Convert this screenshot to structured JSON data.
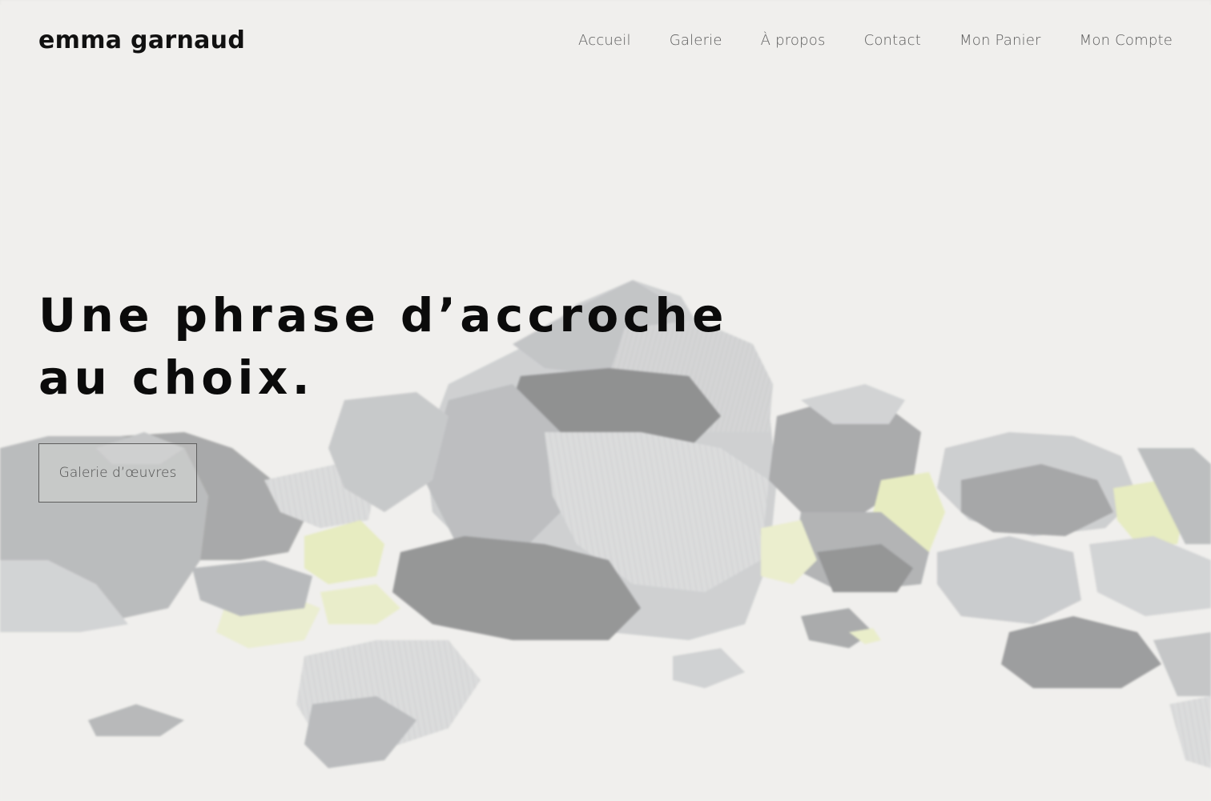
{
  "site": {
    "brand": "emma garnaud"
  },
  "nav": {
    "items": [
      {
        "label": "Accueil"
      },
      {
        "label": "Galerie"
      },
      {
        "label": "À propos"
      },
      {
        "label": "Contact"
      },
      {
        "label": "Mon Panier"
      },
      {
        "label": "Mon Compte"
      }
    ]
  },
  "hero": {
    "headline_line1": "Une phrase d’accroche",
    "headline_line2": "au choix.",
    "cta_label": "Galerie d’œuvres",
    "background_art": "abstract-rocks-illustration"
  },
  "colors": {
    "background": "#f0efed",
    "text_dark": "#0b0b0b",
    "nav_text": "#5a5a5a",
    "rock_dark": "#8e8e8e",
    "rock_mid": "#b5b8bd",
    "rock_light": "#cfd0d2",
    "accent_yellow": "#e6ebb2"
  }
}
